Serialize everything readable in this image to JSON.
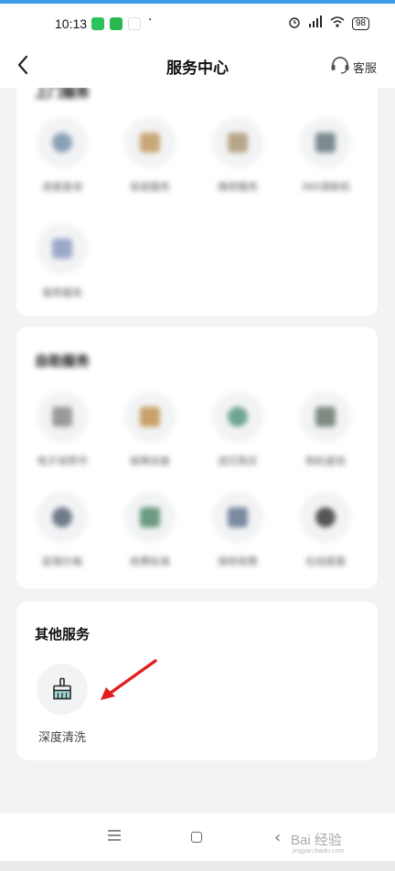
{
  "status": {
    "time": "10:13",
    "battery": "98"
  },
  "header": {
    "title": "服务中心",
    "customer_service": "客服"
  },
  "sections": [
    {
      "title": "上门服务",
      "items": [
        {
          "label": "进度查询",
          "color": "#8aa0b5"
        },
        {
          "label": "安装服务",
          "color": "#c9a877"
        },
        {
          "label": "维修服务",
          "color": "#b8a68a"
        },
        {
          "label": "360清新机",
          "color": "#7a8a8f"
        },
        {
          "label": "保养服务",
          "color": "#9aa8c8"
        }
      ]
    },
    {
      "title": "自助服务",
      "items": [
        {
          "label": "电子说明书",
          "color": "#9a9a9a"
        },
        {
          "label": "故障自查",
          "color": "#c9a16a"
        },
        {
          "label": "滤芯购买",
          "color": "#6ea592"
        },
        {
          "label": "购机查验",
          "color": "#7c8a80"
        },
        {
          "label": "延保价格",
          "color": "#6f7a8a"
        },
        {
          "label": "收费标准",
          "color": "#6a9a80"
        },
        {
          "label": "保修政策",
          "color": "#7a8aa0"
        },
        {
          "label": "在线客服",
          "color": "#555555"
        }
      ]
    },
    {
      "title": "其他服务",
      "items": [
        {
          "label": "深度清洗",
          "icon": "brush-icon",
          "color": "#2a2a2a"
        }
      ]
    }
  ],
  "watermark": {
    "brand": "Bai 经验",
    "url": "jingyan.baidu.com"
  },
  "accent": "#e02020"
}
